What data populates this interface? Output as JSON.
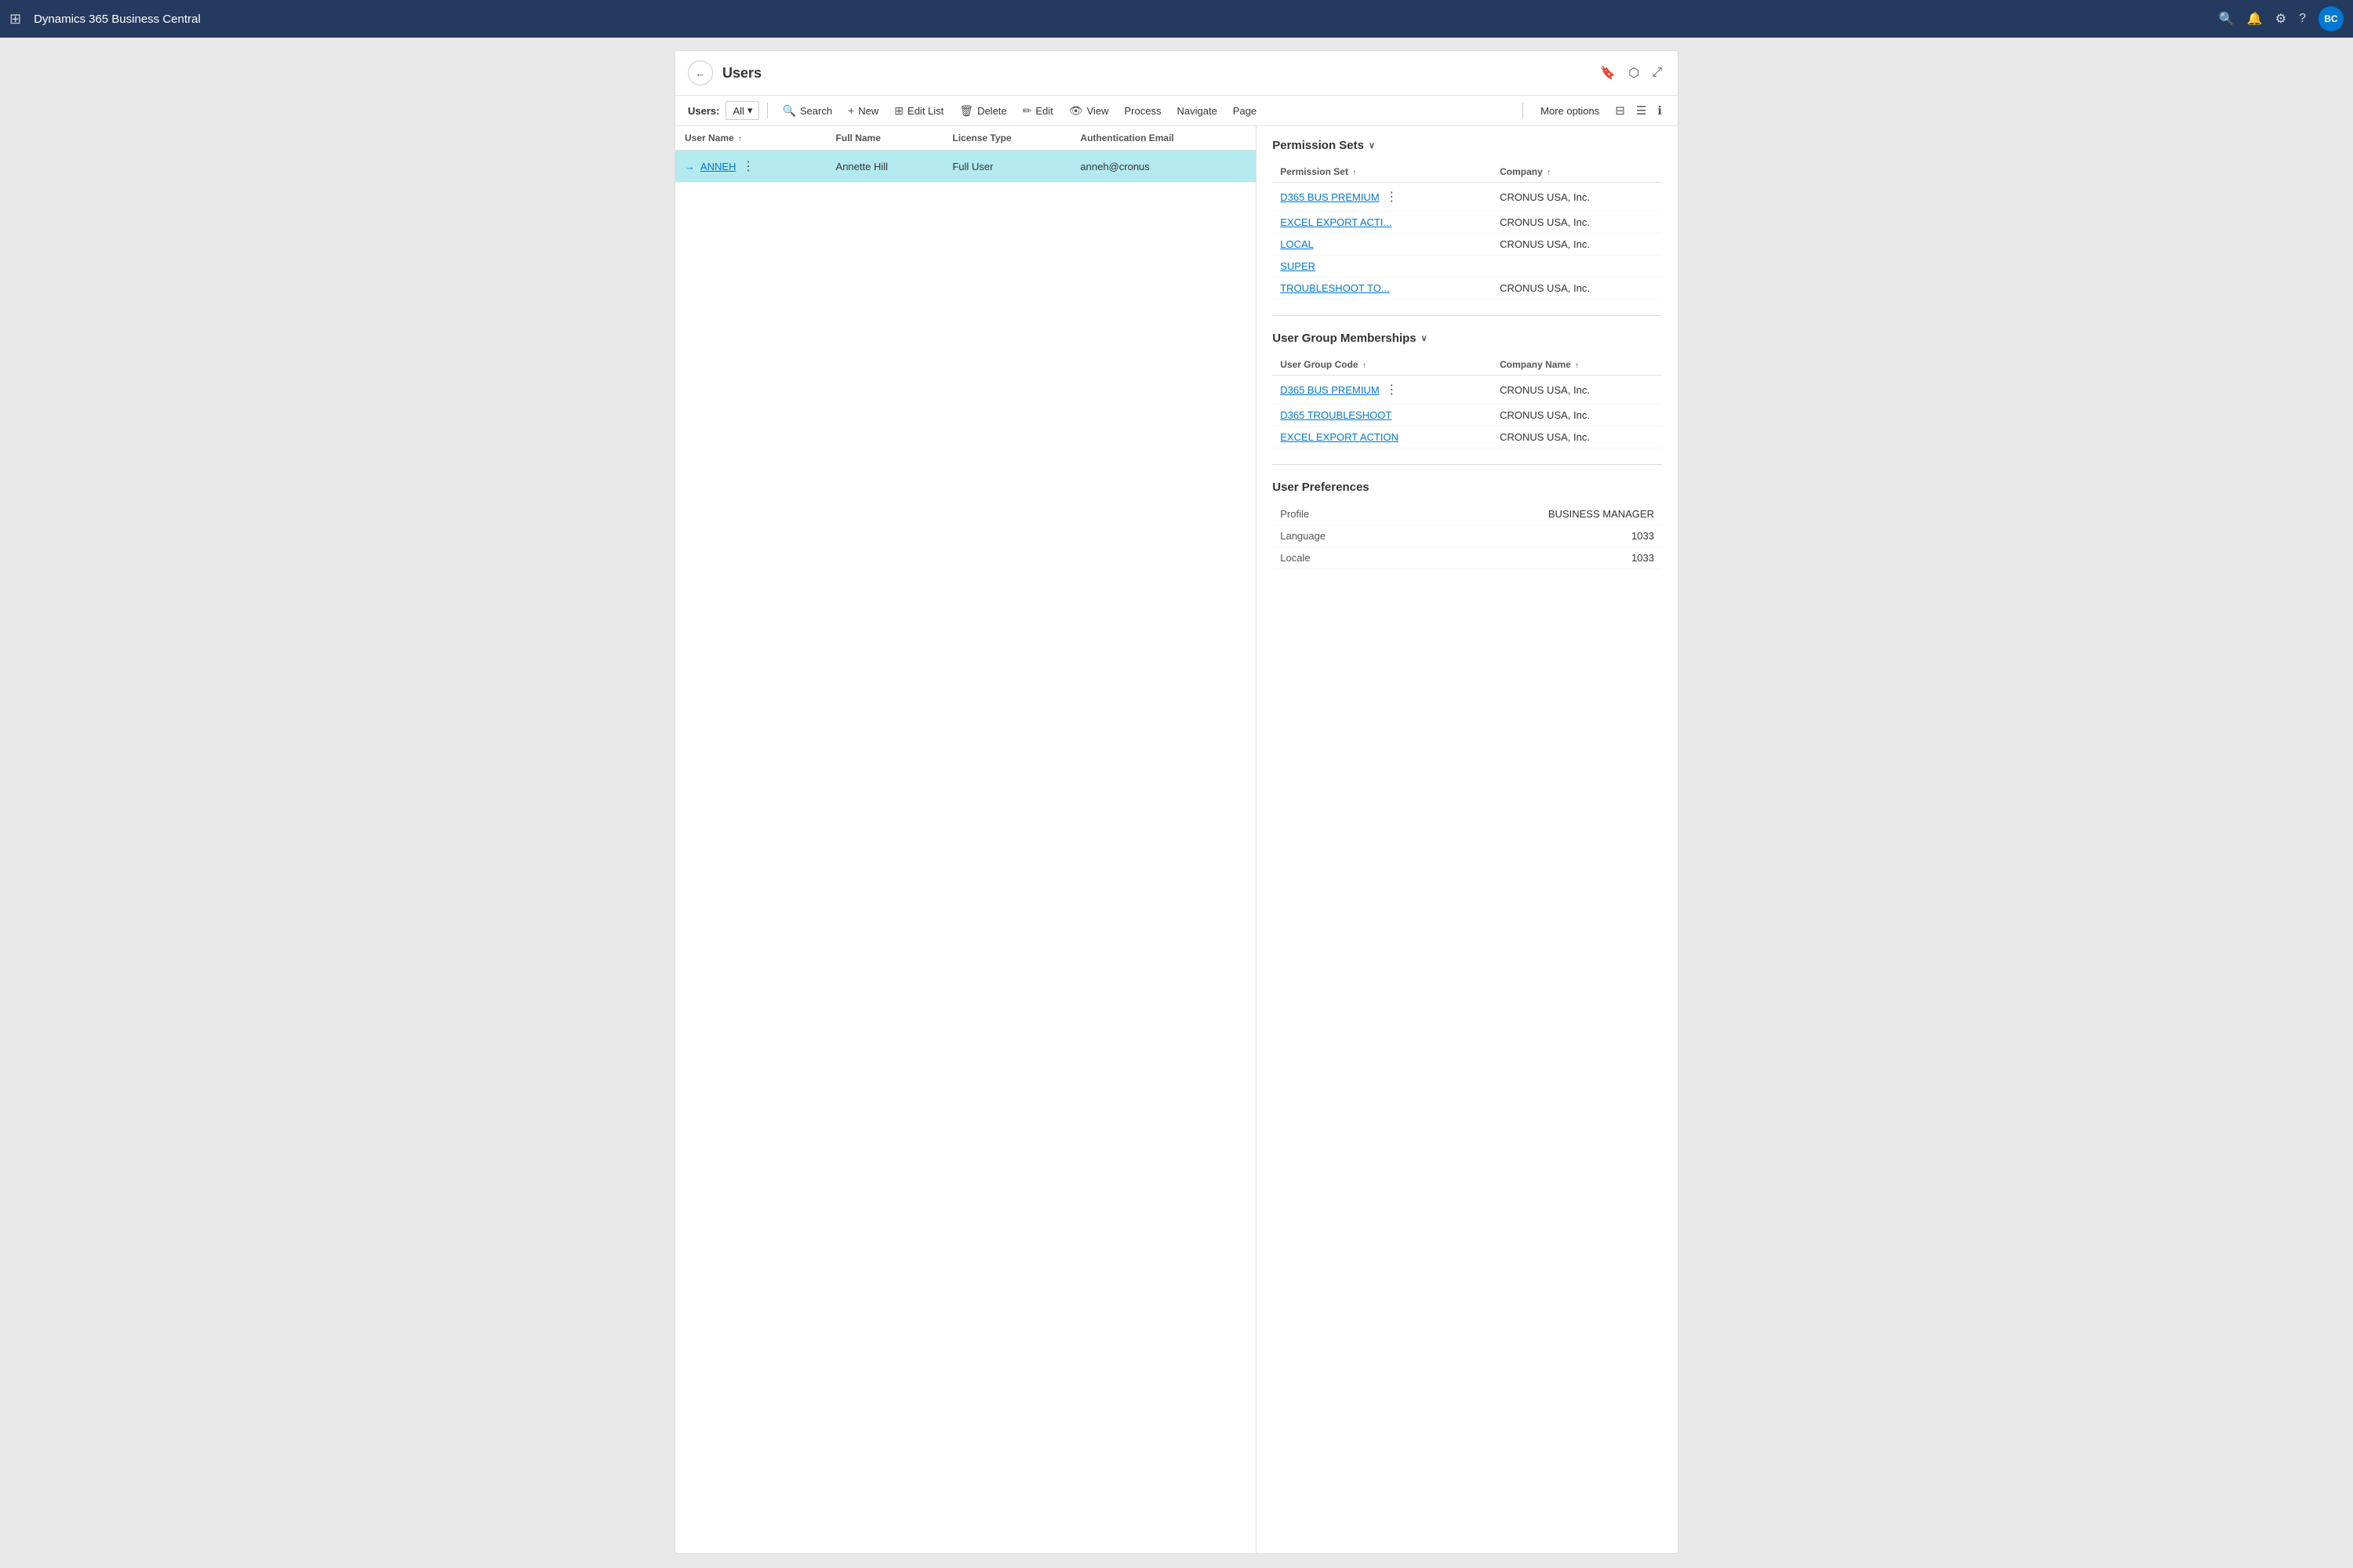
{
  "topbar": {
    "app_title": "Dynamics 365 Business Central",
    "avatar_initials": "BC"
  },
  "page": {
    "title": "Users",
    "back_label": "←",
    "bookmark_icon": "🔖",
    "open_new_icon": "⬡",
    "expand_icon": "⤢"
  },
  "toolbar": {
    "filter_label": "Users:",
    "filter_value": "All",
    "search_label": "Search",
    "new_label": "New",
    "edit_list_label": "Edit List",
    "delete_label": "Delete",
    "edit_label": "Edit",
    "view_label": "View",
    "process_label": "Process",
    "navigate_label": "Navigate",
    "page_label": "Page",
    "more_options_label": "More options"
  },
  "table": {
    "columns": [
      {
        "key": "username",
        "label": "User Name",
        "sortable": true
      },
      {
        "key": "fullname",
        "label": "Full Name",
        "sortable": false
      },
      {
        "key": "licensetype",
        "label": "License Type",
        "sortable": false
      },
      {
        "key": "authEmail",
        "label": "Authentication Email",
        "sortable": false
      }
    ],
    "rows": [
      {
        "username": "ANNEH",
        "fullname": "Annette Hill",
        "licensetype": "Full User",
        "authEmail": "anneh@cronus",
        "selected": true
      }
    ]
  },
  "detail": {
    "permission_sets_section": {
      "title": "Permission Sets",
      "columns": [
        {
          "key": "permissionSet",
          "label": "Permission Set",
          "sortable": true
        },
        {
          "key": "company",
          "label": "Company",
          "sortable": true
        }
      ],
      "rows": [
        {
          "permissionSet": "D365 BUS PREMIUM",
          "company": "CRONUS USA, Inc.",
          "hasMenu": true
        },
        {
          "permissionSet": "EXCEL EXPORT ACTI...",
          "company": "CRONUS USA, Inc.",
          "hasMenu": false
        },
        {
          "permissionSet": "LOCAL",
          "company": "CRONUS USA, Inc.",
          "hasMenu": false
        },
        {
          "permissionSet": "SUPER",
          "company": "",
          "hasMenu": false
        },
        {
          "permissionSet": "TROUBLESHOOT TO...",
          "company": "CRONUS USA, Inc.",
          "hasMenu": false
        }
      ]
    },
    "user_group_memberships_section": {
      "title": "User Group Memberships",
      "columns": [
        {
          "key": "groupCode",
          "label": "User Group Code",
          "sortable": true
        },
        {
          "key": "companyName",
          "label": "Company Name",
          "sortable": true
        }
      ],
      "rows": [
        {
          "groupCode": "D365 BUS PREMIUM",
          "companyName": "CRONUS USA, Inc.",
          "hasMenu": true
        },
        {
          "groupCode": "D365 TROUBLESHOOT",
          "companyName": "CRONUS USA, Inc.",
          "hasMenu": false
        },
        {
          "groupCode": "EXCEL EXPORT ACTION",
          "companyName": "CRONUS USA, Inc.",
          "hasMenu": false
        }
      ]
    },
    "user_preferences_section": {
      "title": "User Preferences",
      "rows": [
        {
          "label": "Profile",
          "value": "BUSINESS MANAGER"
        },
        {
          "label": "Language",
          "value": "1033"
        },
        {
          "label": "Locale",
          "value": "1033"
        }
      ]
    }
  }
}
